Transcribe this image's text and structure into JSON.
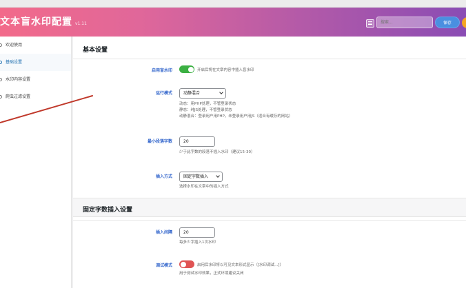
{
  "header": {
    "title": "文本盲水印配置",
    "version": "v1.11",
    "search_placeholder": "搜索...",
    "save_label": "保存"
  },
  "sidebar": {
    "items": [
      {
        "label": "欢迎使用"
      },
      {
        "label": "基础设置"
      },
      {
        "label": "水印内容设置"
      },
      {
        "label": "爬虫过滤设置"
      }
    ]
  },
  "basic": {
    "title": "基本设置",
    "enable": {
      "label": "启用盲水印",
      "enabled": true,
      "description": "开启后将在文章内容中插入盲水印"
    },
    "mode": {
      "label": "运行模式",
      "value": "动静混合",
      "lines": [
        "动态：用PHP处理，不管登录状态",
        "静态：纯JS处理，不管登录状态",
        "动静混合：登录用户用PHP，未登录用户用JS（适合有缓存的网站）"
      ]
    },
    "min_len": {
      "label": "最小段落字数",
      "value": "20",
      "description": "少于此字数的段落不插入水印（建议15-30）"
    },
    "insert": {
      "label": "插入方式",
      "value": "固定字数插入",
      "description": "选择水印在文章中的插入方式"
    }
  },
  "fixed": {
    "title": "固定字数插入设置",
    "interval": {
      "label": "插入间隔",
      "value": "20",
      "description": "每多少字插入1次水印"
    },
    "debug": {
      "label": "调试模式",
      "enabled": false,
      "description": "启用后水印将以可见文本形式显示（[水印调试...]）",
      "note": "用于测试水印效果，正式环境建议关闭"
    }
  },
  "colors": {
    "accent": "#2271b1",
    "toggle_on": "#3cb043",
    "toggle_off": "#e05454",
    "annotation_arrow": "#c0392b"
  }
}
